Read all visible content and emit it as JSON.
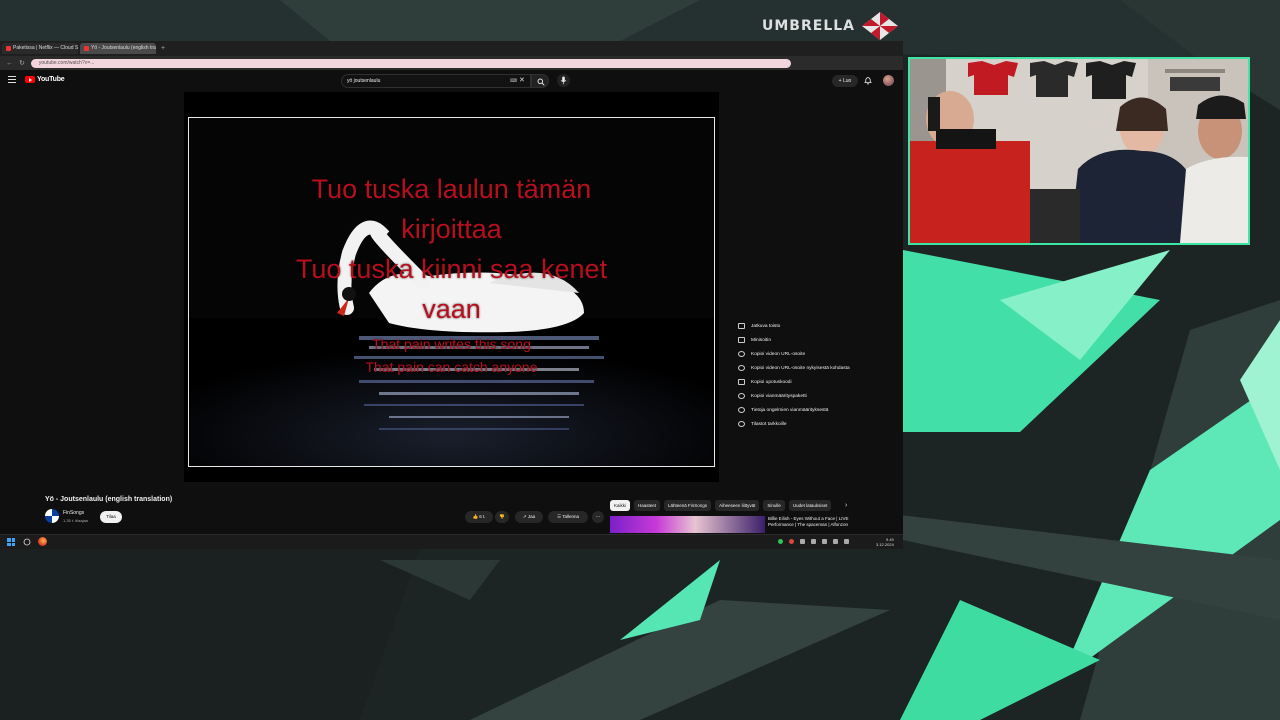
{
  "browser": {
    "tabs": [
      {
        "label": "Paketissa | Netflix — Cloud St",
        "active": false
      },
      {
        "label": "Yö - Joutsenlaulu (english tra",
        "active": true
      }
    ],
    "url": "youtube.com/watch?v=..."
  },
  "youtube": {
    "logo_text": "YouTube",
    "search_query": "yö joutsenlaulu",
    "create_label": "Luo",
    "video_title": "Yö - Joutsenlaulu (english translation)",
    "channel_name": "FinSongs",
    "channel_subs": "1,35 t. tilaajaa",
    "subscribe_label": "Tilaa",
    "like_count": "6 t.",
    "share_label": "Jaa",
    "save_label": "Tallenna",
    "chips": [
      {
        "label": "Kaikki",
        "active": true
      },
      {
        "label": "Haasteet",
        "active": false
      },
      {
        "label": "Lähteenä FinSongs",
        "active": false
      },
      {
        "label": "Aiheeseen liittyvät",
        "active": false
      },
      {
        "label": "Sinulle",
        "active": false
      },
      {
        "label": "Uudet latauksiset",
        "active": false
      }
    ],
    "recommended_title": "Billie Eilish - Eyes Without a Face | LIVE Performance | The spaceman | Alfonzon",
    "context_menu": [
      {
        "label": "Jatkuva toisto",
        "icon": "loop-icon"
      },
      {
        "label": "Minisoitin",
        "icon": "miniplayer-icon"
      },
      {
        "label": "Kopioi videon URL-osoite",
        "icon": "link-icon"
      },
      {
        "label": "Kopioi videon URL-osoite nykyisestä kohdasta",
        "icon": "link-icon"
      },
      {
        "label": "Kopioi upotuskoodi",
        "icon": "code-icon"
      },
      {
        "label": "Kopioi vianmäärityspaketti",
        "icon": "gear-icon"
      },
      {
        "label": "Tietoja ongelmien vianmäärityksestä",
        "icon": "help-icon"
      },
      {
        "label": "Tilastot tarkkoille",
        "icon": "info-icon"
      }
    ]
  },
  "lyrics": {
    "finnish": [
      "Tuo tuska laulun tämän",
      "kirjoittaa",
      "Tuo tuska kiinni saa kenet",
      "vaan"
    ],
    "english": [
      "That pain writes this song",
      "That pain can catch anyone"
    ]
  },
  "taskbar": {
    "time": "9.49",
    "date": "3.12.2024"
  },
  "overlay": {
    "logo_text": "UMBRELLA",
    "accent_color": "#3ee6a5",
    "lyric_color": "#b80f1e"
  }
}
